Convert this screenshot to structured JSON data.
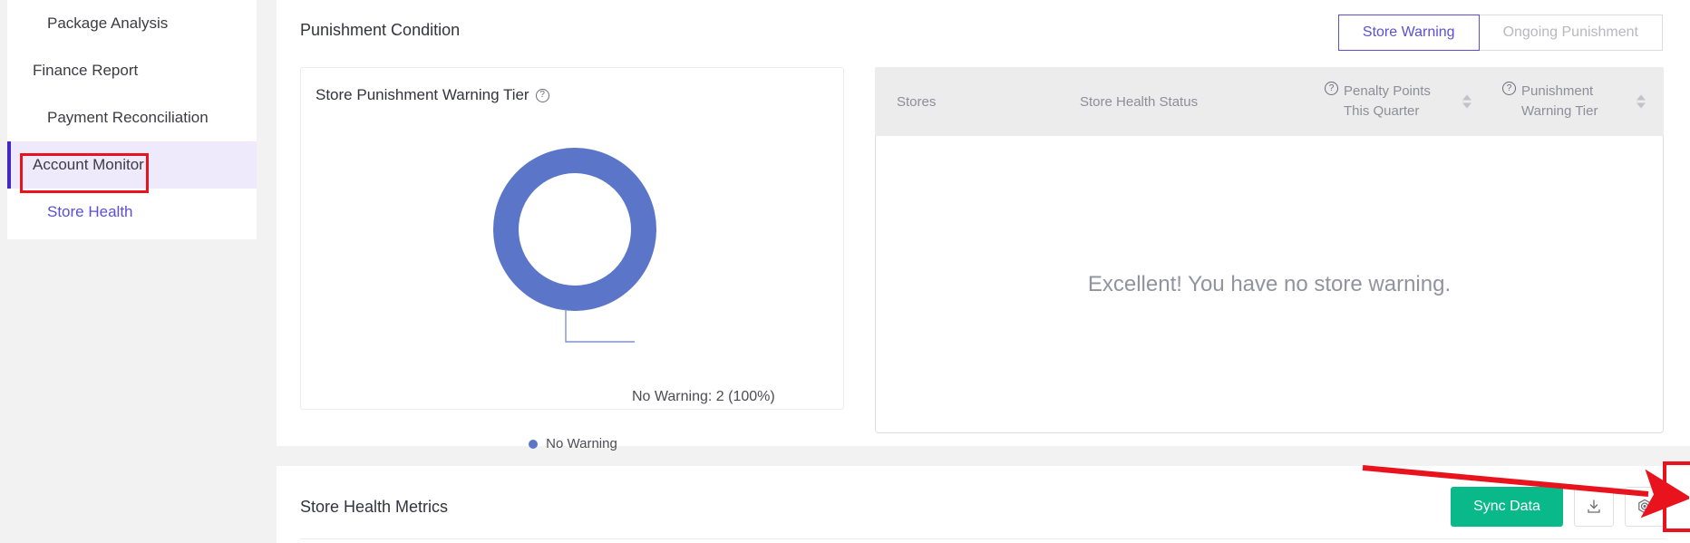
{
  "sidebar": {
    "items": [
      {
        "label": "Package Analysis",
        "level": 2,
        "state": "normal"
      },
      {
        "label": "Finance Report",
        "level": 1,
        "state": "normal"
      },
      {
        "label": "Payment Reconciliation",
        "level": 2,
        "state": "normal"
      },
      {
        "label": "Account Monitor",
        "level": 1,
        "state": "active-group"
      },
      {
        "label": "Store Health",
        "level": 2,
        "state": "active-leaf"
      }
    ]
  },
  "header": {
    "title": "Punishment Condition",
    "tabs": [
      {
        "label": "Store Warning",
        "active": true
      },
      {
        "label": "Ongoing Punishment",
        "active": false
      }
    ]
  },
  "donut_card": {
    "title": "Store Punishment Warning Tier",
    "help_icon": "question-circle-icon",
    "slice_label": "No Warning: 2 (100%)",
    "legend": [
      {
        "label": "No Warning",
        "color": "#5b76c9"
      }
    ]
  },
  "chart_data": {
    "type": "pie",
    "title": "Store Punishment Warning Tier",
    "subtitle": "",
    "donut": true,
    "categories": [
      "No Warning"
    ],
    "values": [
      2
    ],
    "percentages": [
      100
    ],
    "colors": [
      "#5b76c9"
    ],
    "data_labels": [
      "No Warning: 2 (100%)"
    ],
    "legend_position": "bottom",
    "total": 2
  },
  "table": {
    "columns": [
      {
        "label": "Stores",
        "has_help": false,
        "sortable": false
      },
      {
        "label": "Store Health Status",
        "has_help": false,
        "sortable": false
      },
      {
        "label": "Penalty Points This Quarter",
        "line1": "Penalty Points",
        "line2": "This Quarter",
        "has_help": true,
        "sortable": true
      },
      {
        "label": "Punishment Warning Tier",
        "line1": "Punishment",
        "line2": "Warning Tier",
        "has_help": true,
        "sortable": true
      }
    ],
    "rows": [],
    "empty_message": "Excellent! You have no store warning."
  },
  "metrics": {
    "title": "Store Health Metrics",
    "sync_label": "Sync Data",
    "sync_color": "#0ab98a",
    "download_icon": "download-icon",
    "settings_icon": "target-settings-icon"
  },
  "annotations": {
    "highlight_color": "#e8131c",
    "boxes": [
      "store-health-nav",
      "sync-data-button"
    ],
    "arrow": "points-to-sync-data-button"
  }
}
